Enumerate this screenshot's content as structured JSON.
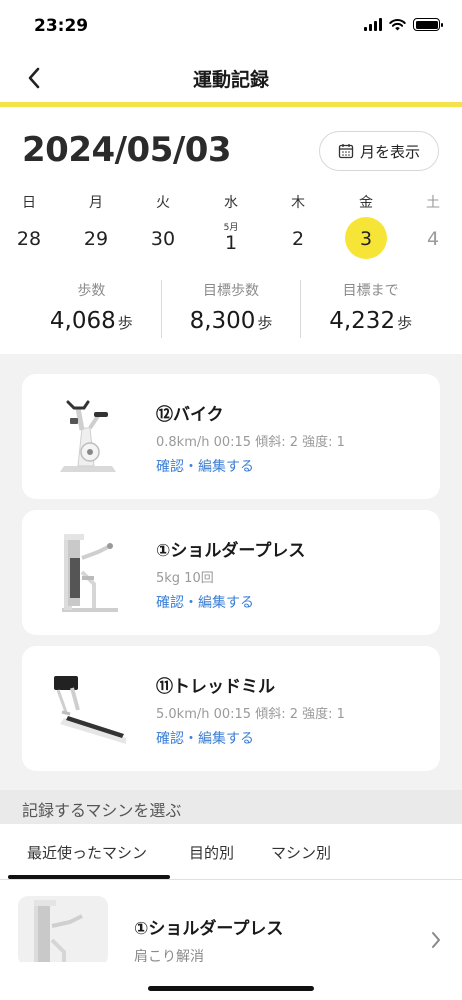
{
  "status": {
    "time": "23:29"
  },
  "nav": {
    "title": "運動記録"
  },
  "date": {
    "title": "2024/05/03",
    "month_button": "月を表示"
  },
  "week": [
    {
      "name": "日",
      "num": "28",
      "month": "",
      "selected": false,
      "dim": false
    },
    {
      "name": "月",
      "num": "29",
      "month": "",
      "selected": false,
      "dim": false
    },
    {
      "name": "火",
      "num": "30",
      "month": "",
      "selected": false,
      "dim": false
    },
    {
      "name": "水",
      "num": "1",
      "month": "5月",
      "selected": false,
      "dim": false
    },
    {
      "name": "木",
      "num": "2",
      "month": "",
      "selected": false,
      "dim": false
    },
    {
      "name": "金",
      "num": "3",
      "month": "",
      "selected": true,
      "dim": false
    },
    {
      "name": "土",
      "num": "4",
      "month": "",
      "selected": false,
      "dim": true
    }
  ],
  "stats": {
    "steps": {
      "label": "歩数",
      "value": "4,068",
      "unit": "歩"
    },
    "goal": {
      "label": "目標歩数",
      "value": "8,300",
      "unit": "歩"
    },
    "remaining": {
      "label": "目標まで",
      "value": "4,232",
      "unit": "歩"
    }
  },
  "records": [
    {
      "title": "⑫バイク",
      "detail": "0.8km/h 00:15 傾斜: 2 強度: 1",
      "link": "確認・編集する",
      "icon": "exercise-bike-icon"
    },
    {
      "title": "①ショルダープレス",
      "detail": "5kg 10回",
      "link": "確認・編集する",
      "icon": "shoulder-press-machine-icon"
    },
    {
      "title": "⑪トレッドミル",
      "detail": "5.0km/h 00:15 傾斜: 2 強度: 1",
      "link": "確認・編集する",
      "icon": "treadmill-icon"
    }
  ],
  "section": {
    "title": "記録するマシンを選ぶ"
  },
  "tabs": {
    "recent": "最近使ったマシン",
    "purpose": "目的別",
    "machine": "マシン別"
  },
  "machine_list": [
    {
      "title": "①ショルダープレス",
      "sub": "肩こり解消"
    }
  ],
  "colors": {
    "accent": "#f6e536",
    "link": "#3b7fd6"
  }
}
